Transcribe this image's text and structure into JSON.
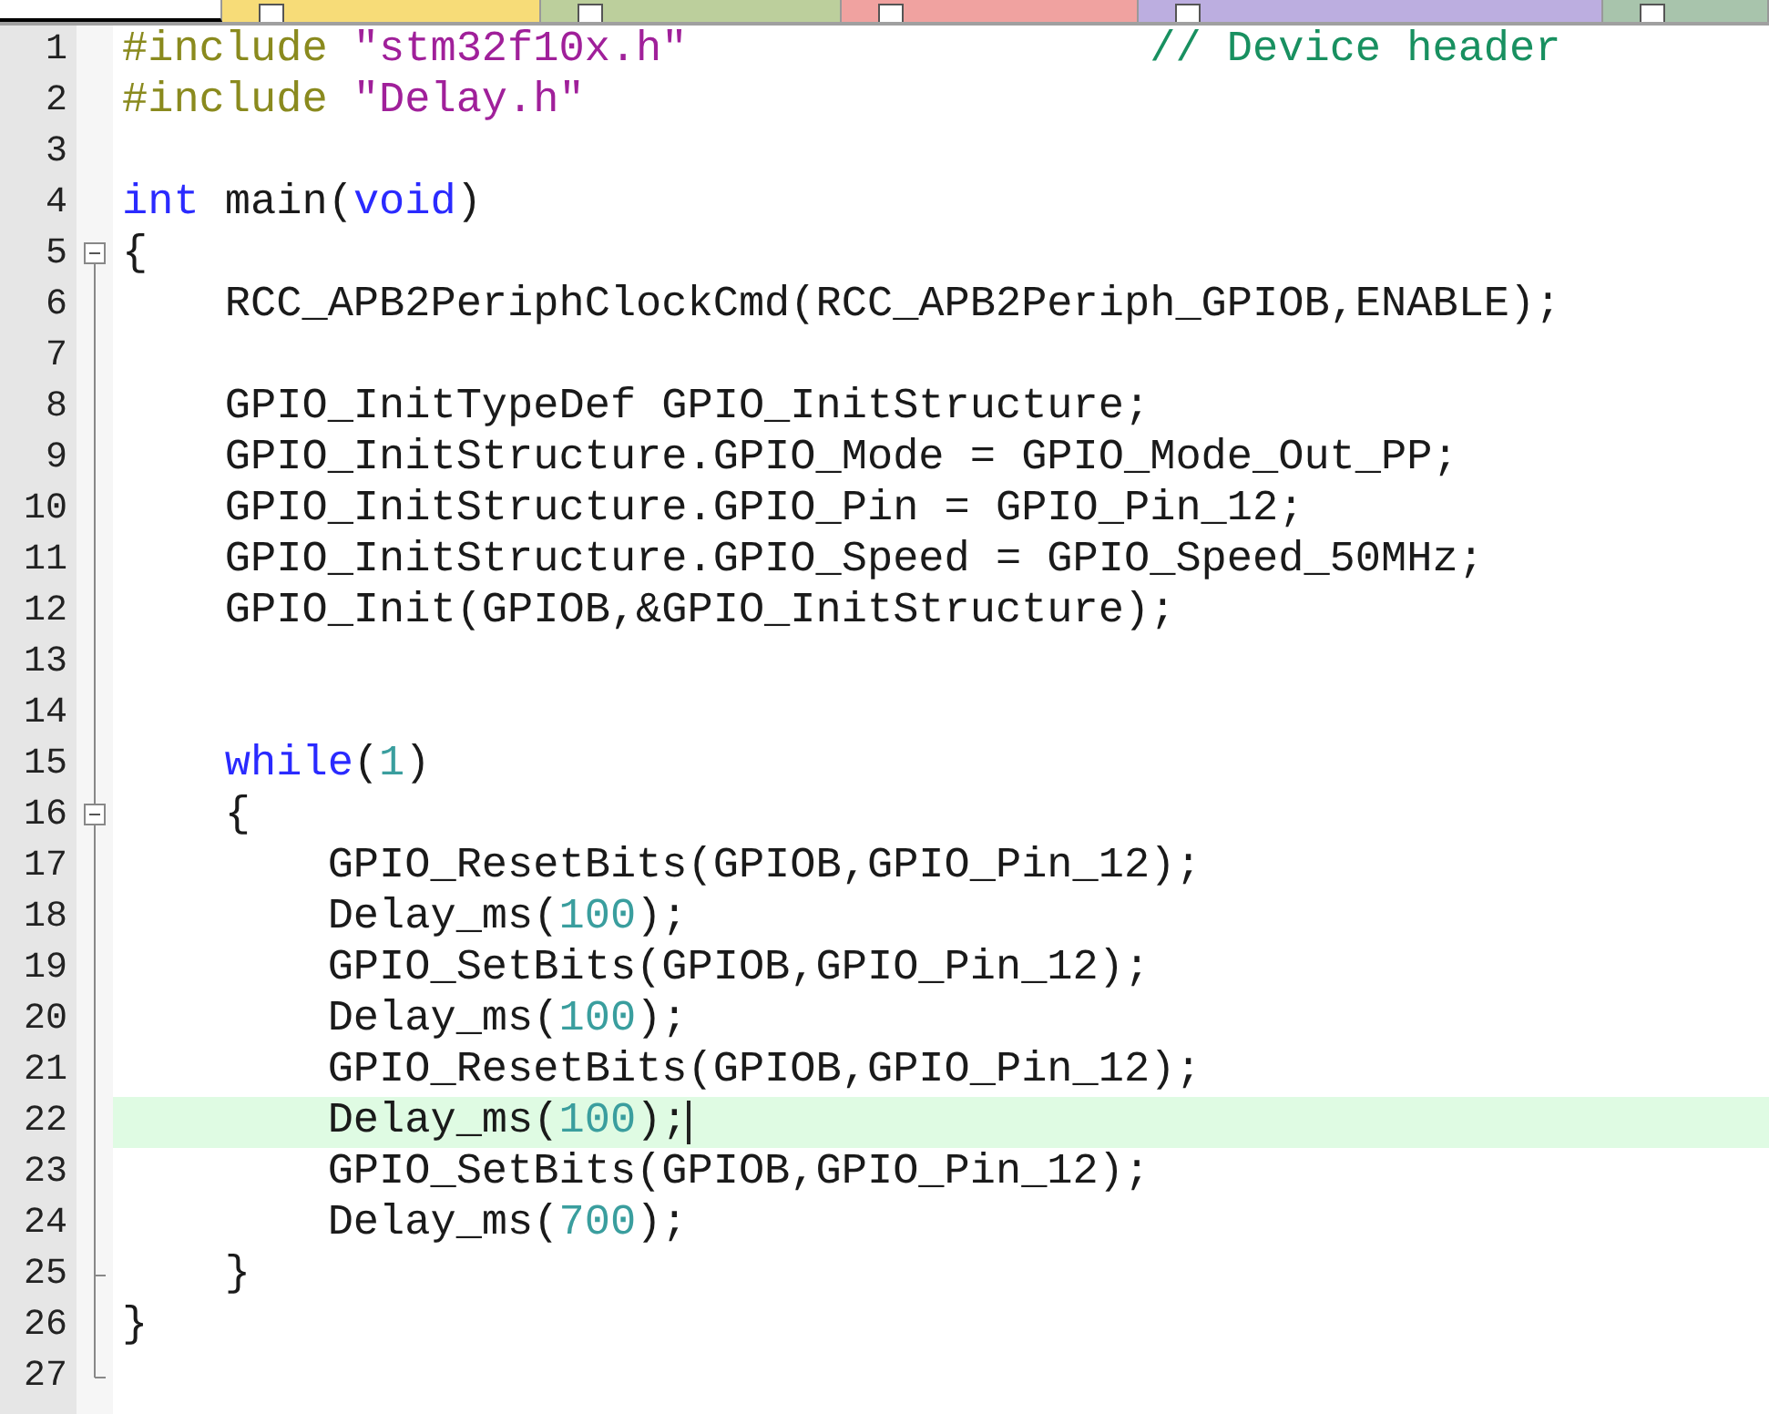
{
  "tabs": [
    {
      "selected": true,
      "color": "#ffffff"
    },
    {
      "selected": false,
      "color": "#f7dc78"
    },
    {
      "selected": false,
      "color": "#bccf9c"
    },
    {
      "selected": false,
      "color": "#f0a2a0"
    },
    {
      "selected": false,
      "color": "#bcaee0"
    },
    {
      "selected": false,
      "color": "#a8c4ac"
    }
  ],
  "lines": [
    {
      "number": "1",
      "current": false,
      "tokens": [
        {
          "kind": "preproc",
          "text": "#include "
        },
        {
          "kind": "string",
          "text": "\"stm32f10x.h\""
        },
        {
          "kind": "comment",
          "text": "                  // Device header"
        }
      ]
    },
    {
      "number": "2",
      "current": false,
      "tokens": [
        {
          "kind": "preproc",
          "text": "#include "
        },
        {
          "kind": "string",
          "text": "\"Delay.h\""
        }
      ]
    },
    {
      "number": "3",
      "current": false
    },
    {
      "number": "4",
      "current": false,
      "tokens": [
        {
          "kind": "keyword",
          "text": "int"
        },
        {
          "kind": "plain",
          "text": " main("
        },
        {
          "kind": "keyword",
          "text": "void"
        },
        {
          "kind": "plain",
          "text": ")"
        }
      ]
    },
    {
      "number": "5",
      "current": false,
      "expanded": true,
      "tokens": [
        {
          "kind": "plain",
          "text": "{"
        }
      ]
    },
    {
      "number": "6",
      "current": false,
      "tokens": [
        {
          "kind": "plain",
          "text": "    RCC_APB2PeriphClockCmd(RCC_APB2Periph_GPIOB,ENABLE);"
        }
      ]
    },
    {
      "number": "7",
      "current": false
    },
    {
      "number": "8",
      "current": false,
      "tokens": [
        {
          "kind": "plain",
          "text": "    GPIO_InitTypeDef GPIO_InitStructure;"
        }
      ]
    },
    {
      "number": "9",
      "current": false,
      "tokens": [
        {
          "kind": "plain",
          "text": "    GPIO_InitStructure.GPIO_Mode = GPIO_Mode_Out_PP;"
        }
      ]
    },
    {
      "number": "10",
      "current": false,
      "tokens": [
        {
          "kind": "plain",
          "text": "    GPIO_InitStructure.GPIO_Pin = GPIO_Pin_12;"
        }
      ]
    },
    {
      "number": "11",
      "current": false,
      "tokens": [
        {
          "kind": "plain",
          "text": "    GPIO_InitStructure.GPIO_Speed = GPIO_Speed_50MHz;"
        }
      ]
    },
    {
      "number": "12",
      "current": false,
      "tokens": [
        {
          "kind": "plain",
          "text": "    GPIO_Init(GPIOB,&GPIO_InitStructure);"
        }
      ]
    },
    {
      "number": "13",
      "current": false
    },
    {
      "number": "14",
      "current": false
    },
    {
      "number": "15",
      "current": false,
      "tokens": [
        {
          "kind": "keyword",
          "text": "    while"
        },
        {
          "kind": "plain",
          "text": "("
        },
        {
          "kind": "number",
          "text": "1"
        },
        {
          "kind": "plain",
          "text": ")"
        }
      ]
    },
    {
      "number": "16",
      "current": false,
      "expanded": true,
      "tokens": [
        {
          "kind": "plain",
          "text": "    {"
        }
      ]
    },
    {
      "number": "17",
      "current": false,
      "tokens": [
        {
          "kind": "plain",
          "text": "        GPIO_ResetBits(GPIOB,GPIO_Pin_12);"
        }
      ]
    },
    {
      "number": "18",
      "current": false,
      "tokens": [
        {
          "kind": "plain",
          "text": "        Delay_ms("
        },
        {
          "kind": "number",
          "text": "100"
        },
        {
          "kind": "plain",
          "text": ");"
        }
      ]
    },
    {
      "number": "19",
      "current": false,
      "tokens": [
        {
          "kind": "plain",
          "text": "        GPIO_SetBits(GPIOB,GPIO_Pin_12);"
        }
      ]
    },
    {
      "number": "20",
      "current": false,
      "tokens": [
        {
          "kind": "plain",
          "text": "        Delay_ms("
        },
        {
          "kind": "number",
          "text": "100"
        },
        {
          "kind": "plain",
          "text": ");"
        }
      ]
    },
    {
      "number": "21",
      "current": false,
      "tokens": [
        {
          "kind": "plain",
          "text": "        GPIO_ResetBits(GPIOB,GPIO_Pin_12);"
        }
      ]
    },
    {
      "number": "22",
      "current": true,
      "tokens": [
        {
          "kind": "plain",
          "text": "        Delay_ms("
        },
        {
          "kind": "number",
          "text": "100"
        },
        {
          "kind": "plain",
          "text": ");"
        }
      ]
    },
    {
      "number": "23",
      "current": false,
      "tokens": [
        {
          "kind": "plain",
          "text": "        GPIO_SetBits(GPIOB,GPIO_Pin_12);"
        }
      ]
    },
    {
      "number": "24",
      "current": false,
      "tokens": [
        {
          "kind": "plain",
          "text": "        Delay_ms("
        },
        {
          "kind": "number",
          "text": "700"
        },
        {
          "kind": "plain",
          "text": ");"
        }
      ]
    },
    {
      "number": "25",
      "current": false,
      "fold_end": true,
      "tokens": [
        {
          "kind": "plain",
          "text": "    }"
        }
      ]
    },
    {
      "number": "26",
      "current": false,
      "tokens": [
        {
          "kind": "plain",
          "text": "}"
        }
      ]
    },
    {
      "number": "27",
      "current": false,
      "fold_end": true
    }
  ]
}
